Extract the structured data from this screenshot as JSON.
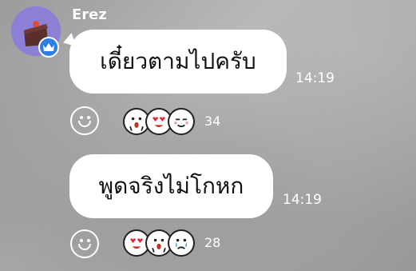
{
  "sender": {
    "name": "Erez"
  },
  "messages": [
    {
      "text": "เดี๋ยวตามไปครับ",
      "time": "14:19",
      "reactions": {
        "count": "34",
        "emojis": [
          "shocked-face-icon",
          "heart-eyes-face-icon",
          "smug-face-icon"
        ]
      }
    },
    {
      "text": "พูดจริงไม่โกหก",
      "time": "14:19",
      "reactions": {
        "count": "28",
        "emojis": [
          "heart-eyes-face-icon",
          "shocked-face-icon",
          "crying-face-icon"
        ]
      }
    }
  ],
  "colors": {
    "badge": "#2f7de1",
    "avatar_bg": "#8c7fd6",
    "bubble": "#ffffff",
    "text_on_bg": "#ffffff"
  }
}
